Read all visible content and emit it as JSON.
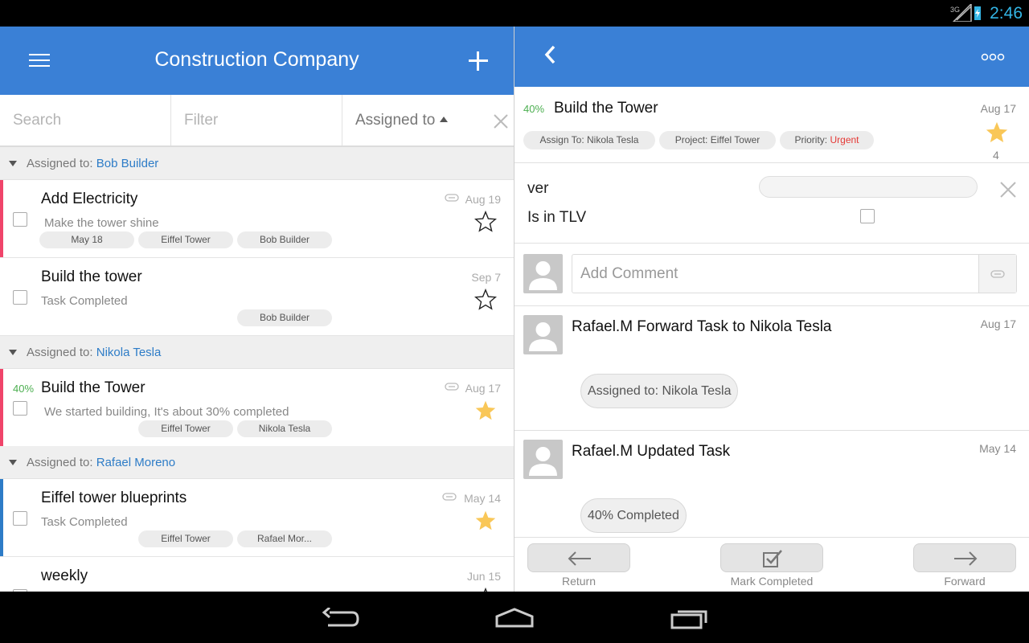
{
  "status_bar": {
    "time": "2:46",
    "network": "3G"
  },
  "left_pane": {
    "title": "Construction Company",
    "search": {
      "placeholder": "Search"
    },
    "filter": {
      "placeholder": "Filter"
    },
    "sort": {
      "label": "Assigned to"
    },
    "groups": [
      {
        "prefix": "Assigned to:",
        "name": "Bob Builder",
        "tasks": [
          {
            "title": "Add Electricity",
            "subtitle": "Make the tower shine",
            "date": "Aug 19",
            "starred": false,
            "accent": "#f0446a",
            "chips": [
              "May 18",
              "Eiffel Tower",
              "Bob Builder"
            ]
          },
          {
            "title": "Build the tower",
            "subtitle": "Task Completed",
            "date": "Sep 7",
            "starred": false,
            "accent": "",
            "chips": [
              "Bob Builder"
            ]
          }
        ]
      },
      {
        "prefix": "Assigned to:",
        "name": "Nikola Tesla",
        "tasks": [
          {
            "progress": "40%",
            "title": "Build the Tower",
            "subtitle": "We started building, It's about 30% completed",
            "date": "Aug 17",
            "starred": true,
            "accent": "#f0446a",
            "chips": [
              "Eiffel Tower",
              "Nikola Tesla"
            ]
          }
        ]
      },
      {
        "prefix": "Assigned to:",
        "name": "Rafael Moreno",
        "tasks": [
          {
            "title": "Eiffel tower blueprints",
            "subtitle": "Task Completed",
            "date": "May 14",
            "starred": true,
            "accent": "#2d7cc7",
            "chips": [
              "Eiffel Tower",
              "Rafael Mor..."
            ]
          },
          {
            "title": "weekly",
            "date": "Jun 15"
          }
        ]
      }
    ]
  },
  "right_pane": {
    "task": {
      "progress": "40%",
      "title": "Build the Tower",
      "date": "Aug 17",
      "star_count": "4",
      "assign_to": "Assign To: Nikola Tesla",
      "project": "Project: Eiffel Tower",
      "priority_label": "Priority:",
      "priority_value": "Urgent"
    },
    "fields": [
      {
        "label": "ver"
      },
      {
        "label": "Is in TLV"
      }
    ],
    "comment": {
      "placeholder": "Add Comment"
    },
    "activity": [
      {
        "text": "Rafael.M  Forward Task to  Nikola Tesla",
        "date": "Aug 17",
        "bubble": "Assigned to:  Nikola Tesla"
      },
      {
        "text": "Rafael.M  Updated Task",
        "date": "May 14",
        "bubble": "40% Completed"
      }
    ],
    "actions": {
      "return": "Return",
      "complete": "Mark Completed",
      "forward": "Forward"
    }
  },
  "colors": {
    "primary": "#3a80d6",
    "link": "#2d7cc7",
    "progress": "#4caf50",
    "star": "#f9c758",
    "urgent": "#e53935"
  },
  "icons": [
    "menu-icon",
    "add-icon",
    "close-icon",
    "paperclip-icon",
    "star-icon",
    "back-icon",
    "more-icon",
    "avatar-icon",
    "arrow-left-icon",
    "checkmark-icon",
    "arrow-right-icon",
    "nav-back-icon",
    "nav-home-icon",
    "nav-recents-icon"
  ]
}
